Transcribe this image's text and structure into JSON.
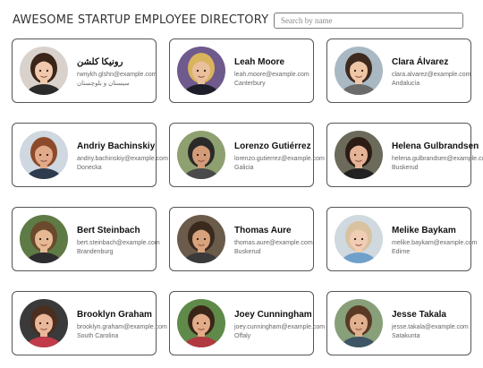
{
  "header": {
    "title": "AWESOME STARTUP EMPLOYEE DIRECTORY",
    "search_placeholder": "Search by name"
  },
  "employees": [
    {
      "name": "رونیکا کلشن",
      "email": "rwnykh.glshn@example.com",
      "location": "سیستان و بلوچستان",
      "avatar": {
        "bg": "#d9d2cc",
        "skin": "#f0c8ad",
        "hair": "#3b2418",
        "shirt": "#2b2b2b"
      }
    },
    {
      "name": "Leah Moore",
      "email": "leah.moore@example.com",
      "location": "Canterbury",
      "avatar": {
        "bg": "#6e5a8c",
        "skin": "#e9bf9c",
        "hair": "#d9b45c",
        "shirt": "#1e1e2a"
      }
    },
    {
      "name": "Clara Álvarez",
      "email": "clara.alvarez@example.com",
      "location": "Andalucía",
      "avatar": {
        "bg": "#a9b9c4",
        "skin": "#efc6a6",
        "hair": "#3e2a1f",
        "shirt": "#6b6b6b"
      }
    },
    {
      "name": "Andriy Bachinskiy",
      "email": "andriy.bachinskiy@example.com",
      "location": "Donecka",
      "avatar": {
        "bg": "#cfd8e0",
        "skin": "#e2a98a",
        "hair": "#8c4a2a",
        "shirt": "#2e3b4e"
      }
    },
    {
      "name": "Lorenzo Gutiérrez",
      "email": "lorenzo.gutierrez@example.com",
      "location": "Galicia",
      "avatar": {
        "bg": "#8ea070",
        "skin": "#d39b78",
        "hair": "#2a2a2a",
        "shirt": "#4a4a4a"
      }
    },
    {
      "name": "Helena Gulbrandsen",
      "email": "helena.gulbrandsen@example.com",
      "location": "Buskerud",
      "avatar": {
        "bg": "#6c6a5a",
        "skin": "#e5b396",
        "hair": "#2b1c15",
        "shirt": "#222222"
      }
    },
    {
      "name": "Bert Steinbach",
      "email": "bert.steinbach@example.com",
      "location": "Brandenburg",
      "avatar": {
        "bg": "#5e7a45",
        "skin": "#e6b894",
        "hair": "#6a4a2c",
        "shirt": "#2d2d30"
      }
    },
    {
      "name": "Thomas Aure",
      "email": "thomas.aure@example.com",
      "location": "Buskerud",
      "avatar": {
        "bg": "#6b5b4a",
        "skin": "#d8a27d",
        "hair": "#3a2a1d",
        "shirt": "#3a3a3a"
      }
    },
    {
      "name": "Melike Baykam",
      "email": "melike.baykam@example.com",
      "location": "Edirne",
      "avatar": {
        "bg": "#cfd9df",
        "skin": "#f0cdb4",
        "hair": "#d9c2a0",
        "shirt": "#6fa0c9"
      }
    },
    {
      "name": "Brooklyn Graham",
      "email": "brooklyn.graham@example.com",
      "location": "South Carolina",
      "avatar": {
        "bg": "#3a3a3a",
        "skin": "#e9b79a",
        "hair": "#4a2e20",
        "shirt": "#c23b4a"
      }
    },
    {
      "name": "Joey Cunningham",
      "email": "joey.cunningham@example.com",
      "location": "Offaly",
      "avatar": {
        "bg": "#5f8a4a",
        "skin": "#e2ac88",
        "hair": "#3a2618",
        "shirt": "#b03a40"
      }
    },
    {
      "name": "Jesse Takala",
      "email": "jesse.takala@example.com",
      "location": "Satakunta",
      "avatar": {
        "bg": "#88a07a",
        "skin": "#e0b08f",
        "hair": "#5a3a25",
        "shirt": "#3d5564"
      }
    }
  ]
}
